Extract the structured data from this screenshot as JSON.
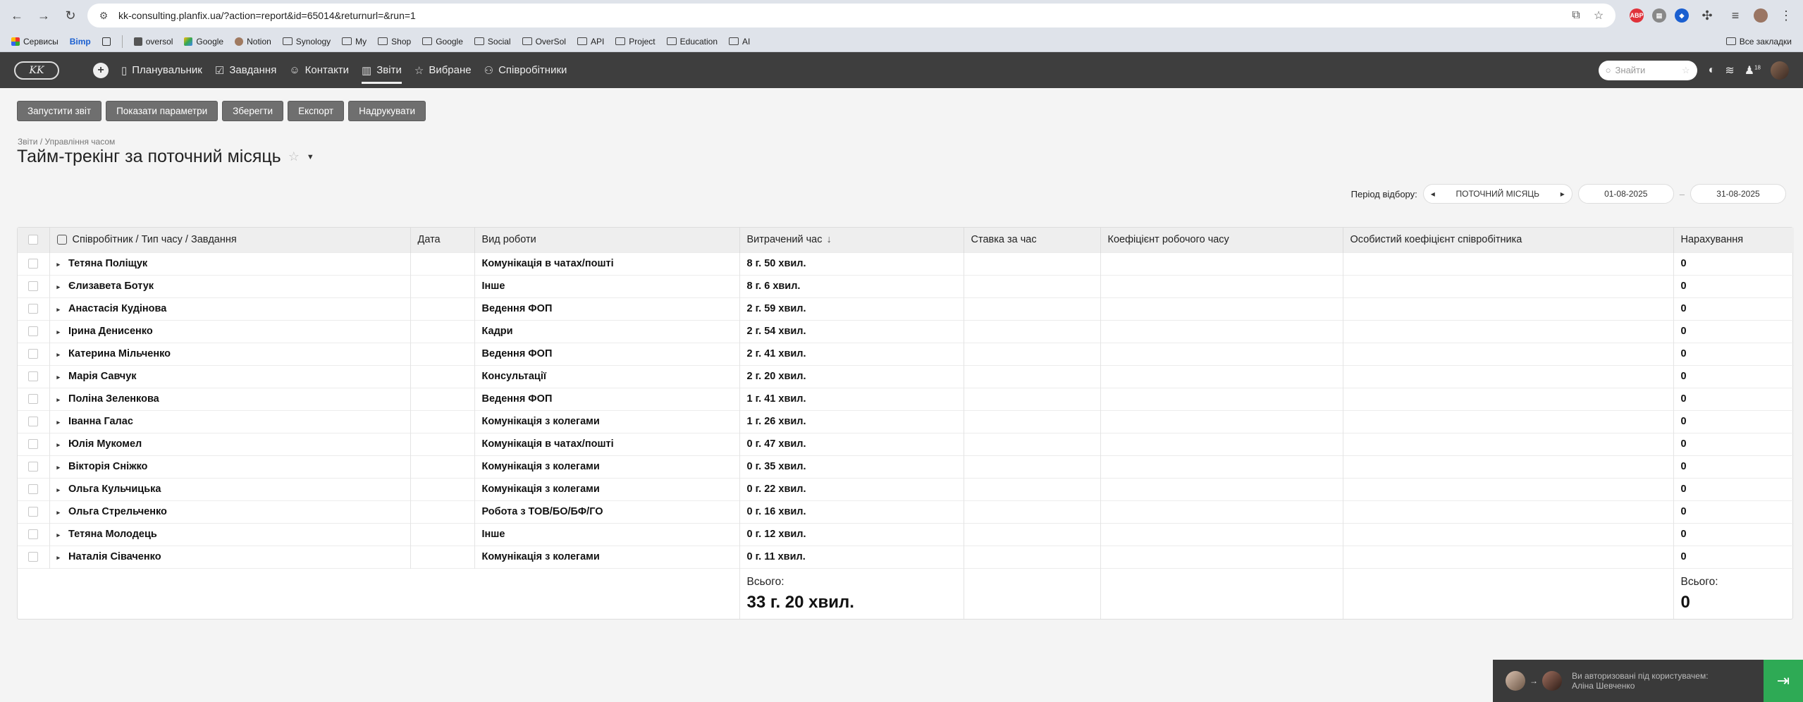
{
  "browser": {
    "url": "kk-consulting.planfix.ua/?action=report&id=65014&returnurl=&run=1",
    "bookmarks": [
      {
        "label": "Сервисы",
        "type": "apps"
      },
      {
        "label": "Bimp",
        "type": "link"
      },
      {
        "label": "oversol",
        "type": "link"
      },
      {
        "label": "Google",
        "type": "link"
      },
      {
        "label": "Notion",
        "type": "link"
      },
      {
        "label": "Synology",
        "type": "folder"
      },
      {
        "label": "My",
        "type": "folder"
      },
      {
        "label": "Shop",
        "type": "folder"
      },
      {
        "label": "Google",
        "type": "folder"
      },
      {
        "label": "Social",
        "type": "folder"
      },
      {
        "label": "OverSol",
        "type": "folder"
      },
      {
        "label": "API",
        "type": "folder"
      },
      {
        "label": "Project",
        "type": "folder"
      },
      {
        "label": "Education",
        "type": "folder"
      },
      {
        "label": "AI",
        "type": "folder"
      }
    ],
    "all_bookmarks": "Все закладки"
  },
  "app": {
    "logo": "KK",
    "menu": [
      {
        "label": "Планувальник",
        "icon": "calendar-icon"
      },
      {
        "label": "Завдання",
        "icon": "tasks-icon"
      },
      {
        "label": "Контакти",
        "icon": "contacts-icon"
      },
      {
        "label": "Звіти",
        "icon": "reports-icon",
        "active": true
      },
      {
        "label": "Вибране",
        "icon": "star-icon"
      },
      {
        "label": "Співробітники",
        "icon": "employees-icon"
      }
    ],
    "search_placeholder": "Знайти",
    "notification_count": "18"
  },
  "toolbar": {
    "run": "Запустити звіт",
    "params": "Показати параметри",
    "save": "Зберегти",
    "export": "Експорт",
    "print": "Надрукувати"
  },
  "breadcrumb": "Звіти / Управління часом",
  "title": "Тайм-трекінг за поточний місяць",
  "period": {
    "label": "Період відбору:",
    "value": "ПОТОЧНИЙ МІСЯЦЬ",
    "from": "01-08-2025",
    "to": "31-08-2025"
  },
  "table": {
    "columns": [
      "Співробітник / Тип часу / Завдання",
      "Дата",
      "Вид роботи",
      "Витрачений час",
      "Ставка за час",
      "Коефіцієнт робочого часу",
      "Особистий коефіцієнт співробітника",
      "Нарахування"
    ],
    "rows": [
      {
        "name": "Тетяна Поліщук",
        "date": "",
        "work": "Комунікація в чатах/пошті",
        "time": "8 г. 50 хвил.",
        "rate": "",
        "k1": "",
        "k2": "",
        "accrual": "0"
      },
      {
        "name": "Єлизавета Ботук",
        "date": "",
        "work": "Інше",
        "time": "8 г. 6 хвил.",
        "rate": "",
        "k1": "",
        "k2": "",
        "accrual": "0"
      },
      {
        "name": "Анастасія Кудінова",
        "date": "",
        "work": "Ведення ФОП",
        "time": "2 г. 59 хвил.",
        "rate": "",
        "k1": "",
        "k2": "",
        "accrual": "0"
      },
      {
        "name": "Ірина Денисенко",
        "date": "",
        "work": "Кадри",
        "time": "2 г. 54 хвил.",
        "rate": "",
        "k1": "",
        "k2": "",
        "accrual": "0"
      },
      {
        "name": "Катерина Мільченко",
        "date": "",
        "work": "Ведення ФОП",
        "time": "2 г. 41 хвил.",
        "rate": "",
        "k1": "",
        "k2": "",
        "accrual": "0"
      },
      {
        "name": "Марія Савчук",
        "date": "",
        "work": "Консультації",
        "time": "2 г. 20 хвил.",
        "rate": "",
        "k1": "",
        "k2": "",
        "accrual": "0"
      },
      {
        "name": "Поліна Зеленкова",
        "date": "",
        "work": "Ведення ФОП",
        "time": "1 г. 41 хвил.",
        "rate": "",
        "k1": "",
        "k2": "",
        "accrual": "0"
      },
      {
        "name": "Іванна Галас",
        "date": "",
        "work": "Комунікація з колегами",
        "time": "1 г. 26 хвил.",
        "rate": "",
        "k1": "",
        "k2": "",
        "accrual": "0"
      },
      {
        "name": "Юлія Мукомел",
        "date": "",
        "work": "Комунікація в чатах/пошті",
        "time": "0 г. 47 хвил.",
        "rate": "",
        "k1": "",
        "k2": "",
        "accrual": "0"
      },
      {
        "name": "Вікторія Сніжко",
        "date": "",
        "work": "Комунікація з колегами",
        "time": "0 г. 35 хвил.",
        "rate": "",
        "k1": "",
        "k2": "",
        "accrual": "0"
      },
      {
        "name": "Ольга Кульчицька",
        "date": "",
        "work": "Комунікація з колегами",
        "time": "0 г. 22 хвил.",
        "rate": "",
        "k1": "",
        "k2": "",
        "accrual": "0"
      },
      {
        "name": "Ольга Стрельченко",
        "date": "",
        "work": "Робота з ТОВ/БО/БФ/ГО",
        "time": "0 г. 16 хвил.",
        "rate": "",
        "k1": "",
        "k2": "",
        "accrual": "0"
      },
      {
        "name": "Тетяна Молодець",
        "date": "",
        "work": "Інше",
        "time": "0 г. 12 хвил.",
        "rate": "",
        "k1": "",
        "k2": "",
        "accrual": "0"
      },
      {
        "name": "Наталія Сіваченко",
        "date": "",
        "work": "Комунікація з колегами",
        "time": "0 г. 11 хвил.",
        "rate": "",
        "k1": "",
        "k2": "",
        "accrual": "0"
      }
    ],
    "total_label": "Всього:",
    "total_time": "33 г. 20 хвил.",
    "total_accrual": "0"
  },
  "impersonation": {
    "text": "Ви авторизовані під користувачем:",
    "user": "Аліна Шевченко"
  }
}
